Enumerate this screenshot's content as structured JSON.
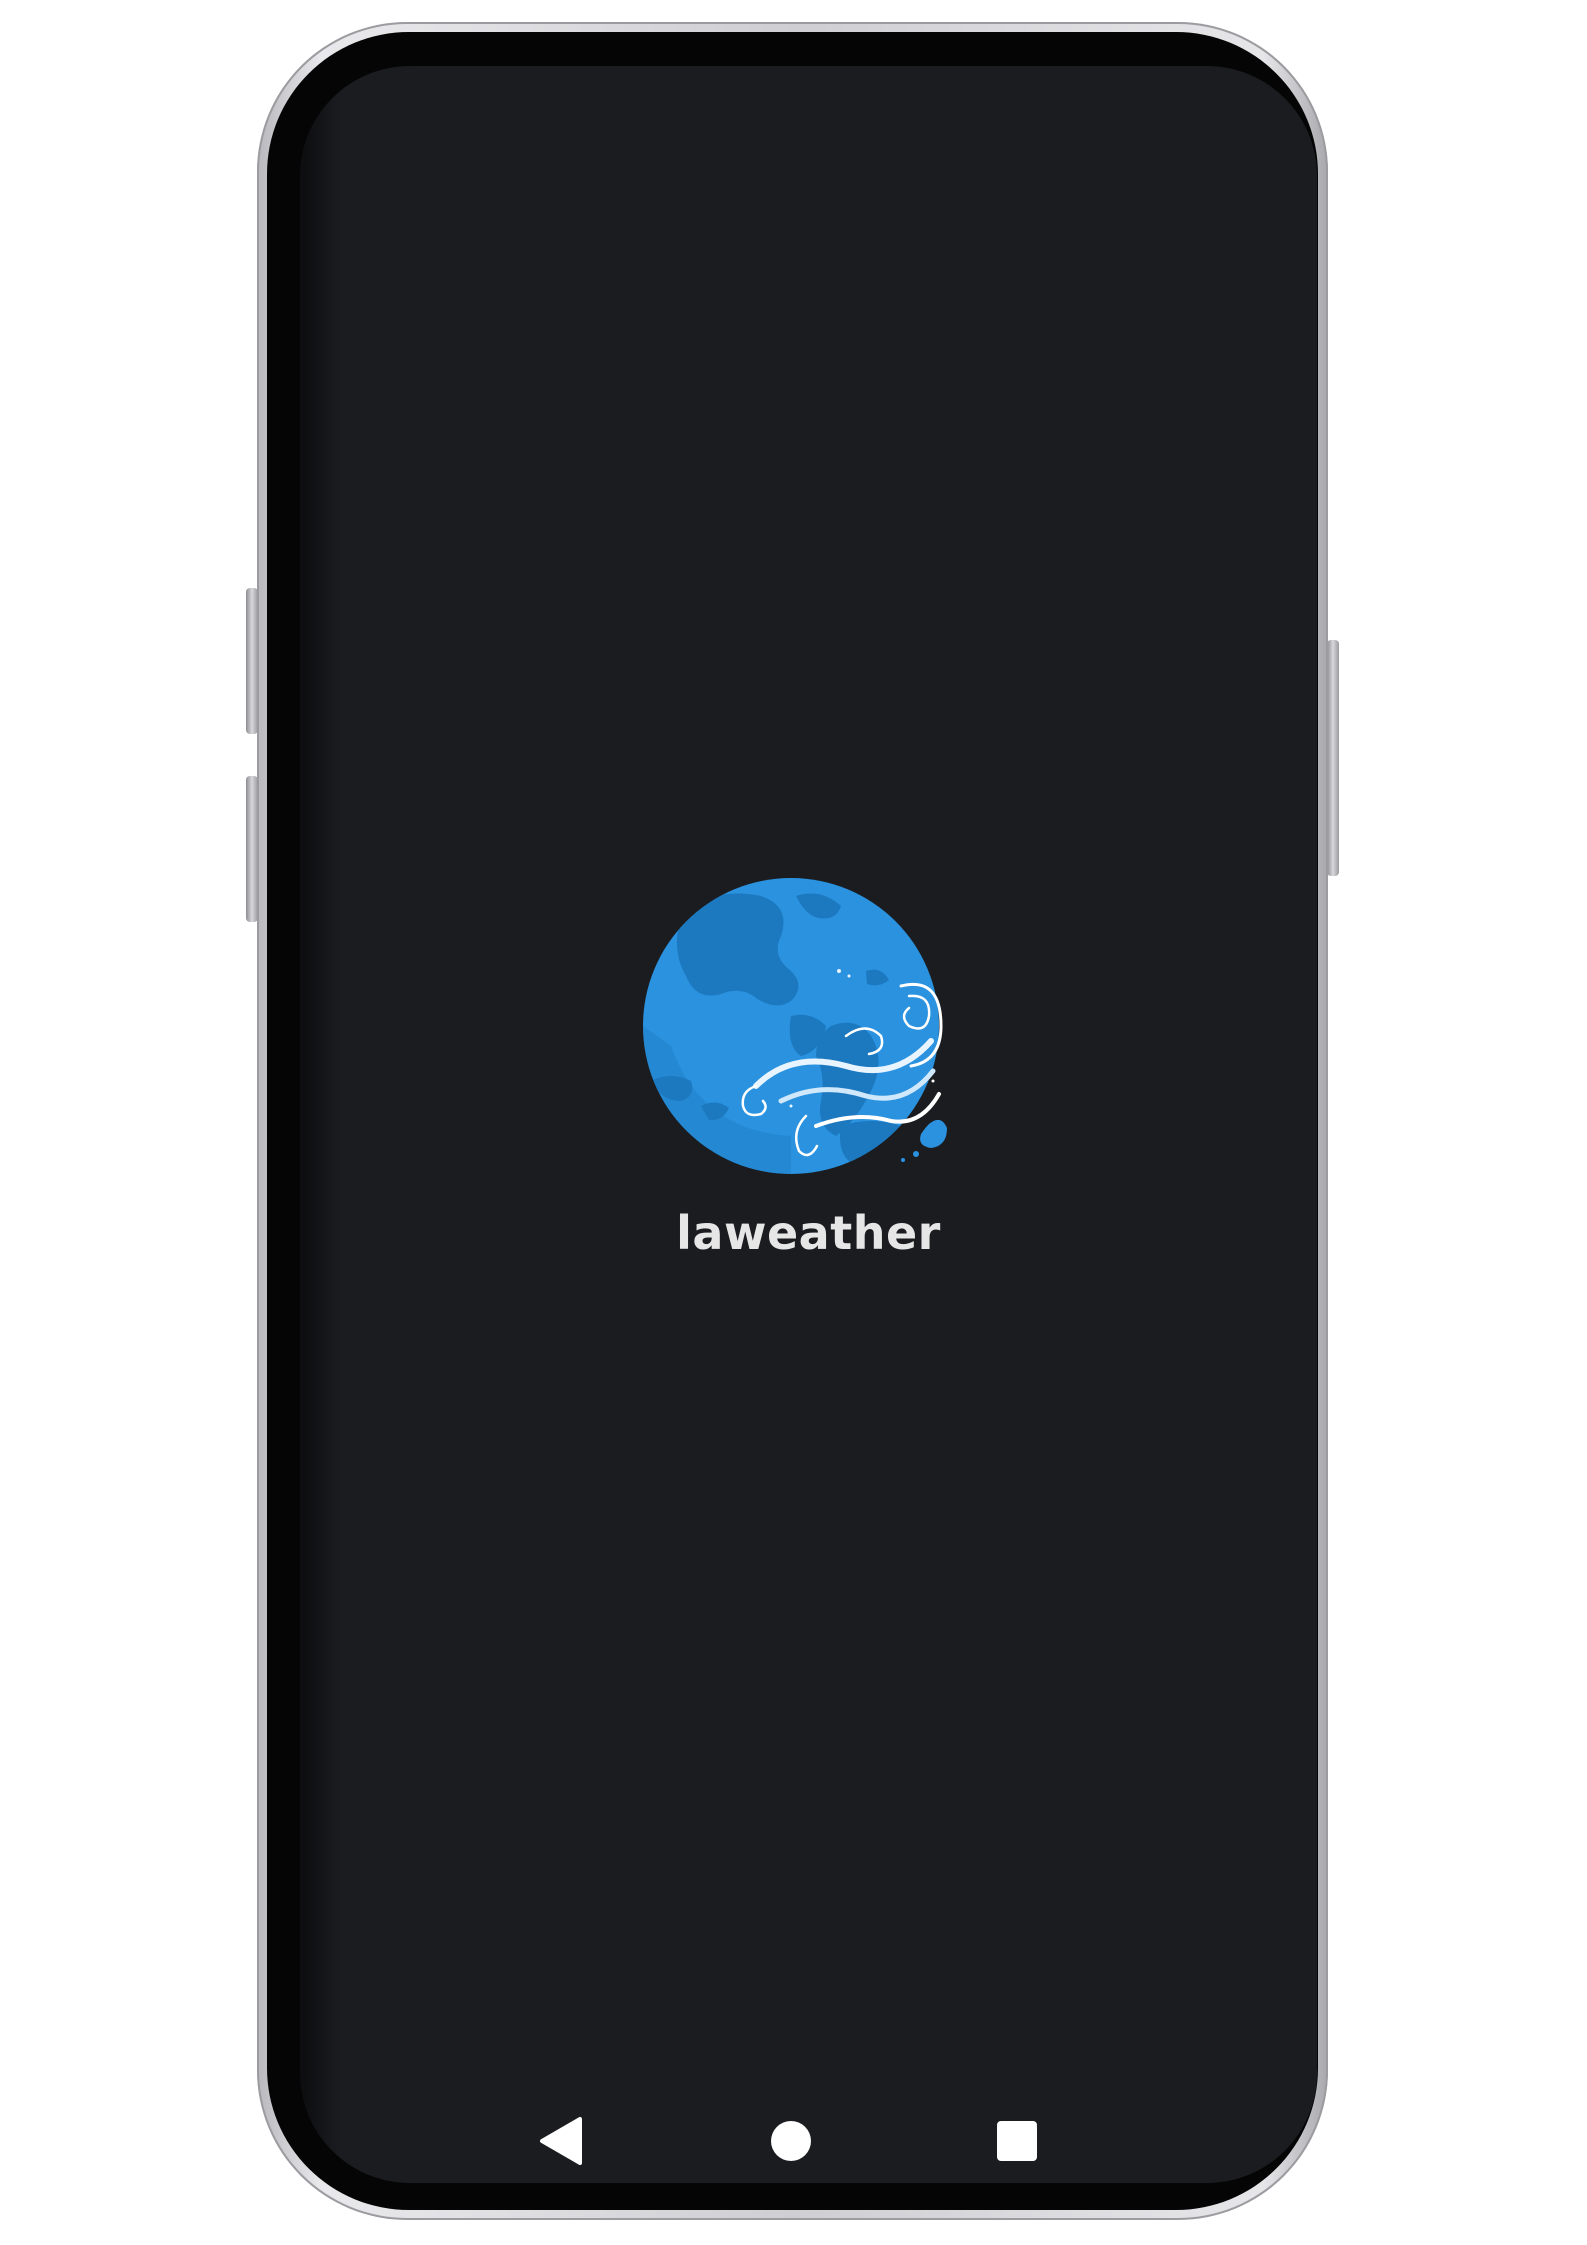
{
  "app": {
    "name": "laweather",
    "logo_icon": "globe-wind-icon",
    "screen_background": "#1b1c20",
    "logo_color": "#2a8fdc",
    "text_color": "#e6e6e6"
  },
  "navigation_bar": {
    "back_icon": "back-triangle-icon",
    "home_icon": "home-circle-icon",
    "recents_icon": "recents-square-icon"
  }
}
